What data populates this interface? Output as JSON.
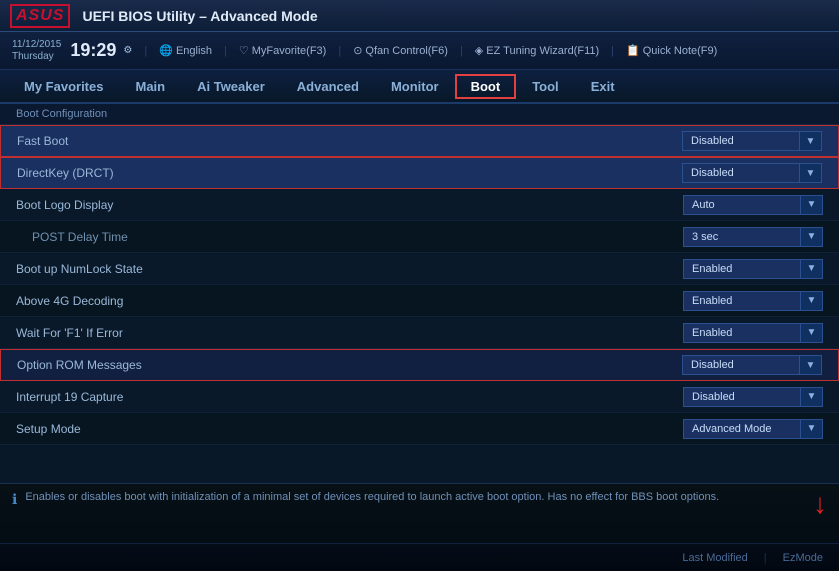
{
  "header": {
    "logo": "ASUS",
    "title": "UEFI BIOS Utility – Advanced Mode"
  },
  "toolbar": {
    "date": "11/12/2015",
    "day": "Thursday",
    "time": "19:29",
    "language": "English",
    "myfavorite": "MyFavorite(F3)",
    "qfan": "Qfan Control(F6)",
    "eztuning": "EZ Tuning Wizard(F11)",
    "quicknote": "Quick Note(F9)"
  },
  "nav": {
    "items": [
      {
        "label": "My Favorites",
        "active": false
      },
      {
        "label": "Main",
        "active": false
      },
      {
        "label": "Ai Tweaker",
        "active": false
      },
      {
        "label": "Advanced",
        "active": false
      },
      {
        "label": "Monitor",
        "active": false
      },
      {
        "label": "Boot",
        "active": true
      },
      {
        "label": "Tool",
        "active": false
      },
      {
        "label": "Exit",
        "active": false
      }
    ]
  },
  "section": {
    "label": "Boot Configuration"
  },
  "rows": [
    {
      "label": "Fast Boot",
      "indent": false,
      "highlighted": true,
      "value": "Disabled"
    },
    {
      "label": "DirectKey (DRCT)",
      "indent": false,
      "highlighted": true,
      "value": "Disabled"
    },
    {
      "label": "Boot Logo Display",
      "indent": false,
      "highlighted": false,
      "value": "Auto"
    },
    {
      "label": "POST Delay Time",
      "indent": true,
      "highlighted": false,
      "value": "3 sec"
    },
    {
      "label": "Boot up NumLock State",
      "indent": false,
      "highlighted": false,
      "value": "Enabled"
    },
    {
      "label": "Above 4G Decoding",
      "indent": false,
      "highlighted": false,
      "value": "Enabled"
    },
    {
      "label": "Wait For 'F1' If Error",
      "indent": false,
      "highlighted": false,
      "value": "Enabled"
    },
    {
      "label": "Option ROM Messages",
      "indent": false,
      "highlighted2": true,
      "value": "Disabled"
    },
    {
      "label": "Interrupt 19 Capture",
      "indent": false,
      "highlighted": false,
      "value": "Disabled"
    },
    {
      "label": "Setup Mode",
      "indent": false,
      "highlighted": false,
      "value": "Advanced Mode"
    }
  ],
  "status": {
    "description": "Enables or disables boot with initialization of a minimal set of devices required to launch active boot option. Has no effect for BBS boot options."
  },
  "bottom": {
    "last_modified": "Last Modified",
    "ez_mode": "EzMode"
  }
}
